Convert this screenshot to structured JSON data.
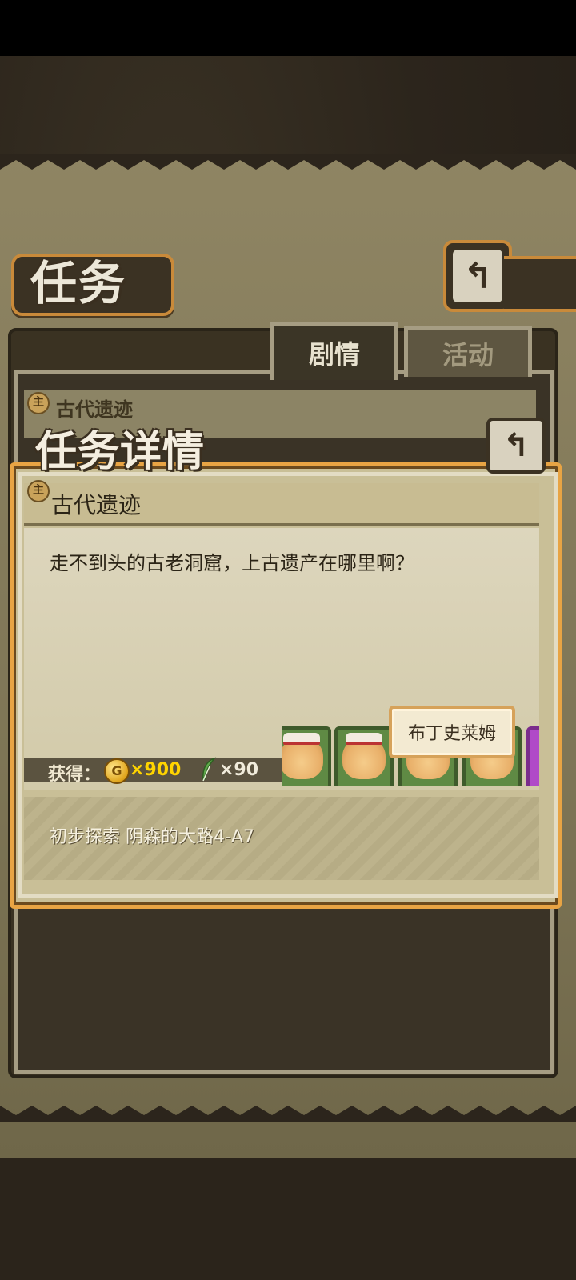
{
  "screen": {
    "title": "任务",
    "back_icon": "back-arrow-icon"
  },
  "tabs": [
    {
      "label": "剧情",
      "active": true
    },
    {
      "label": "活动",
      "active": false
    }
  ],
  "quest_list": {
    "items": [
      {
        "badge": "主",
        "title": "古代遗迹"
      }
    ]
  },
  "detail": {
    "heading": "任务详情",
    "quest_badge": "主",
    "quest_title": "古代遗迹",
    "description": "走不到头的古老洞窟，上古遗产在哪里啊？",
    "rewards_label": "获得：",
    "coin_symbol": "G",
    "coin_amount": "×900",
    "feather_amount": "×90",
    "monster_tooltip": "布丁史莱姆",
    "objective": "初步探索 阴森的大路4-A7"
  },
  "colors": {
    "accent_orange": "#e8a444",
    "coin_text": "#ffd400",
    "frame_light": "#e3dcc4"
  }
}
